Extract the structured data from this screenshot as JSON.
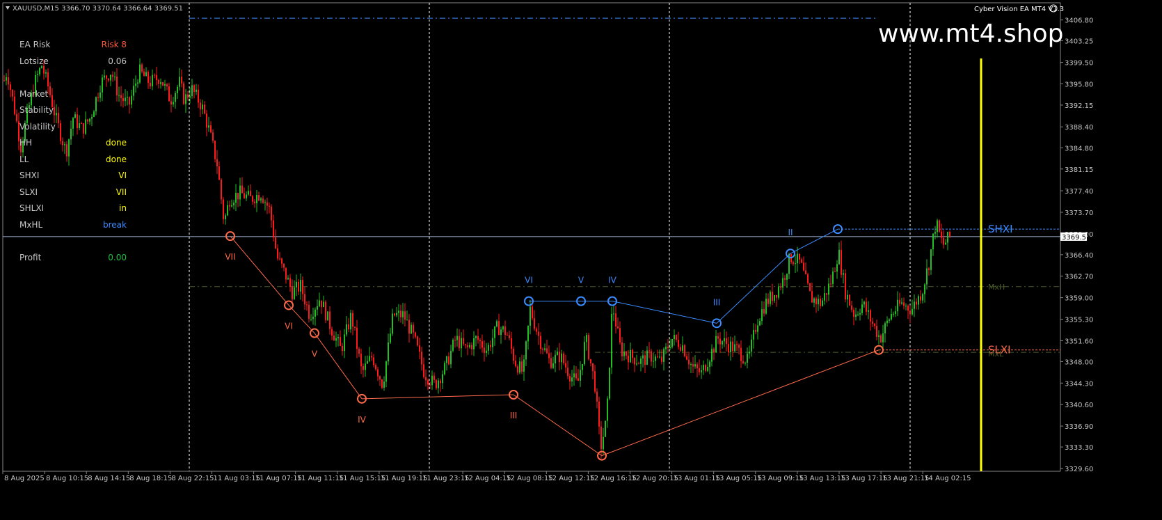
{
  "header": {
    "symbol_info": "XAUUSD,M15  3366.70 3370.64 3366.64 3369.51"
  },
  "ea_title": "Cyber Vision EA MT4 V1.3",
  "watermark": "www.mt4.shop",
  "price_tag": "3369.51",
  "panel": [
    {
      "label": "EA Risk",
      "value": "Risk 8",
      "color": "#ff5a3c"
    },
    {
      "label": "Lotsize",
      "value": "0.06",
      "color": "#c8c8c8"
    },
    {
      "label": "Market",
      "value": "",
      "color": "#c8c8c8"
    },
    {
      "label": "Stability",
      "value": "",
      "color": "#c8c8c8"
    },
    {
      "label": "Volatility",
      "value": "",
      "color": "#c8c8c8"
    },
    {
      "label": "HH",
      "value": "done",
      "color": "#ffff00"
    },
    {
      "label": "LL",
      "value": "done",
      "color": "#ffff00"
    },
    {
      "label": "SHXI",
      "value": "VI",
      "color": "#ffff00"
    },
    {
      "label": "SLXI",
      "value": "VII",
      "color": "#ffff00"
    },
    {
      "label": "SHLXI",
      "value": "in",
      "color": "#ffff00"
    },
    {
      "label": "MxHL",
      "value": "break",
      "color": "#3c8cff"
    },
    {
      "label": "Profit",
      "value": "0.00",
      "color": "#22c040"
    }
  ],
  "levels": {
    "shxi": "SHXI",
    "slxi": "SLXI",
    "mxh": "MxH",
    "mxl": "MxL"
  },
  "colors": {
    "bull": "#22c022",
    "bear": "#ff1a1a",
    "blue": "#3c8cff",
    "orange": "#ff6a4a",
    "yellow": "#ffff00",
    "grid": "#ffffff"
  },
  "chart_data": {
    "type": "candlestick",
    "symbol": "XAUUSD",
    "timeframe": "M15",
    "ylim": [
      3329.6,
      3407.6
    ],
    "y_ticks": [
      3406.8,
      3403.25,
      3399.5,
      3395.8,
      3392.15,
      3388.4,
      3384.8,
      3381.15,
      3377.4,
      3373.7,
      3370.0,
      3366.4,
      3362.7,
      3359.0,
      3355.3,
      3351.6,
      3348.0,
      3344.3,
      3340.6,
      3336.9,
      3333.3,
      3329.6
    ],
    "x_labels": [
      "8 Aug 2025",
      "8 Aug 10:15",
      "8 Aug 14:15",
      "8 Aug 18:15",
      "8 Aug 22:15",
      "11 Aug 03:15",
      "11 Aug 07:15",
      "11 Aug 11:15",
      "11 Aug 15:15",
      "11 Aug 19:15",
      "11 Aug 23:15",
      "12 Aug 04:15",
      "12 Aug 08:15",
      "12 Aug 12:15",
      "12 Aug 16:15",
      "12 Aug 20:15",
      "13 Aug 01:15",
      "13 Aug 05:15",
      "13 Aug 09:15",
      "13 Aug 13:15",
      "13 Aug 17:15",
      "13 Aug 21:15",
      "14 Aug 02:15"
    ],
    "current_price": 3369.51,
    "close_path": [
      [
        0,
        3394
      ],
      [
        10,
        3398
      ],
      [
        20,
        3392
      ],
      [
        30,
        3385
      ],
      [
        40,
        3391
      ],
      [
        50,
        3396
      ],
      [
        60,
        3399
      ],
      [
        70,
        3395
      ],
      [
        80,
        3390
      ],
      [
        95,
        3384
      ],
      [
        105,
        3390
      ],
      [
        118,
        3388
      ],
      [
        130,
        3390
      ],
      [
        145,
        3396
      ],
      [
        160,
        3398
      ],
      [
        170,
        3394
      ],
      [
        185,
        3392
      ],
      [
        200,
        3398
      ],
      [
        215,
        3396
      ],
      [
        230,
        3397
      ],
      [
        245,
        3393
      ],
      [
        258,
        3396
      ],
      [
        265,
        3393
      ],
      [
        275,
        3395
      ],
      [
        290,
        3392
      ],
      [
        300,
        3388
      ],
      [
        312,
        3382
      ],
      [
        322,
        3372
      ],
      [
        330,
        3376
      ],
      [
        345,
        3377
      ],
      [
        360,
        3376
      ],
      [
        375,
        3377
      ],
      [
        388,
        3374
      ],
      [
        398,
        3366
      ],
      [
        410,
        3363
      ],
      [
        420,
        3360
      ],
      [
        432,
        3361
      ],
      [
        445,
        3356
      ],
      [
        460,
        3359
      ],
      [
        475,
        3354
      ],
      [
        490,
        3350
      ],
      [
        505,
        3356
      ],
      [
        520,
        3346
      ],
      [
        535,
        3349
      ],
      [
        550,
        3344
      ],
      [
        565,
        3356
      ],
      [
        580,
        3356
      ],
      [
        595,
        3352
      ],
      [
        610,
        3346
      ],
      [
        625,
        3344
      ],
      [
        640,
        3347
      ],
      [
        655,
        3352
      ],
      [
        670,
        3350
      ],
      [
        685,
        3352
      ],
      [
        700,
        3350
      ],
      [
        715,
        3354
      ],
      [
        728,
        3353
      ],
      [
        740,
        3348
      ],
      [
        752,
        3346
      ],
      [
        762,
        3357
      ],
      [
        775,
        3352
      ],
      [
        790,
        3348
      ],
      [
        805,
        3349
      ],
      [
        818,
        3346
      ],
      [
        830,
        3344
      ],
      [
        842,
        3352
      ],
      [
        855,
        3344
      ],
      [
        863,
        3333
      ],
      [
        872,
        3338
      ],
      [
        880,
        3358
      ],
      [
        892,
        3350
      ],
      [
        905,
        3349
      ],
      [
        920,
        3348
      ],
      [
        935,
        3349
      ],
      [
        950,
        3348
      ],
      [
        965,
        3352
      ],
      [
        980,
        3351
      ],
      [
        995,
        3347
      ],
      [
        1008,
        3346
      ],
      [
        1020,
        3349
      ],
      [
        1032,
        3352
      ],
      [
        1045,
        3351
      ],
      [
        1060,
        3350
      ],
      [
        1075,
        3348
      ],
      [
        1088,
        3355
      ],
      [
        1100,
        3358
      ],
      [
        1115,
        3360
      ],
      [
        1125,
        3362
      ],
      [
        1136,
        3366
      ],
      [
        1150,
        3365
      ],
      [
        1165,
        3359
      ],
      [
        1180,
        3358
      ],
      [
        1195,
        3362
      ],
      [
        1205,
        3367
      ],
      [
        1215,
        3360
      ],
      [
        1228,
        3356
      ],
      [
        1240,
        3358
      ],
      [
        1252,
        3355
      ],
      [
        1265,
        3352
      ],
      [
        1280,
        3356
      ],
      [
        1295,
        3358
      ],
      [
        1310,
        3357
      ],
      [
        1325,
        3360
      ],
      [
        1335,
        3365
      ],
      [
        1345,
        3372
      ],
      [
        1355,
        3368
      ],
      [
        1365,
        3369.5
      ]
    ],
    "zigzag_bear": {
      "name": "orange",
      "points": [
        {
          "x": 331,
          "y": 3369.6,
          "label": "VII"
        },
        {
          "x": 415,
          "y": 3357.7,
          "label": "VI"
        },
        {
          "x": 452,
          "y": 3352.9,
          "label": "V"
        },
        {
          "x": 520,
          "y": 3341.6,
          "label": "IV"
        },
        {
          "x": 738,
          "y": 3342.3,
          "label": "III"
        },
        {
          "x": 865,
          "y": 3331.8,
          "label": ""
        },
        {
          "x": 1263,
          "y": 3350.0,
          "label": ""
        }
      ]
    },
    "zigzag_bull": {
      "name": "blue",
      "points": [
        {
          "x": 760,
          "y": 3358.4,
          "label": "VI"
        },
        {
          "x": 835,
          "y": 3358.4,
          "label": "V"
        },
        {
          "x": 880,
          "y": 3358.4,
          "label": "IV"
        },
        {
          "x": 1030,
          "y": 3354.6,
          "label": "III"
        },
        {
          "x": 1136,
          "y": 3366.6,
          "label": "II"
        },
        {
          "x": 1204,
          "y": 3370.8,
          "label": ""
        }
      ]
    },
    "levels": {
      "shxi": 3370.8,
      "slxi": 3350.0,
      "mxh": 3360.9,
      "mxl": 3349.6,
      "top_dash": 3407.1
    },
    "grid": true
  }
}
